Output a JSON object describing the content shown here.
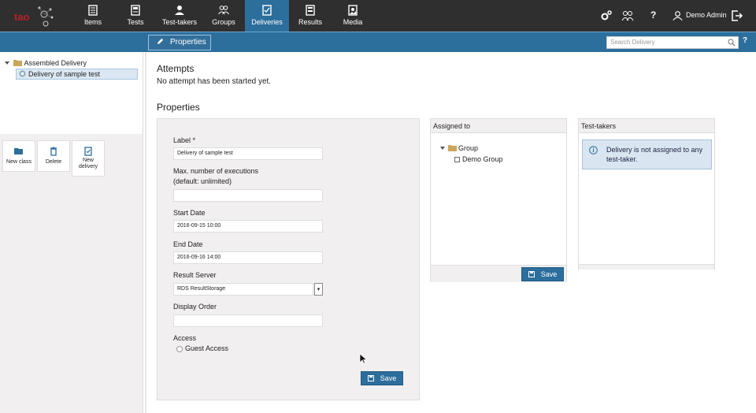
{
  "nav": {
    "items": [
      {
        "label": "Items",
        "icon": "items-icon"
      },
      {
        "label": "Tests",
        "icon": "tests-icon"
      },
      {
        "label": "Test-takers",
        "icon": "test-takers-icon"
      },
      {
        "label": "Groups",
        "icon": "groups-icon"
      },
      {
        "label": "Deliveries",
        "icon": "deliveries-icon",
        "active": true
      },
      {
        "label": "Results",
        "icon": "results-icon"
      },
      {
        "label": "Media",
        "icon": "media-icon"
      }
    ],
    "user_label": "Demo Admin",
    "help_label": "?"
  },
  "subbar": {
    "tab_label": "Properties",
    "search_placeholder": "Search Delivery",
    "help_label": "?"
  },
  "tree": {
    "root_label": "Assembled Delivery",
    "child_label": "Delivery of sample test"
  },
  "actions": {
    "new_class": "New class",
    "delete": "Delete",
    "new_delivery_line1": "New",
    "new_delivery_line2": "delivery"
  },
  "main": {
    "attempts_title": "Attempts",
    "attempts_note": "No attempt has been started yet.",
    "properties_title": "Properties"
  },
  "form": {
    "label_label": "Label *",
    "label_value": "Delivery of sample test",
    "max_exec_label_line1": "Max. number of executions",
    "max_exec_label_line2": "(default: unlimited)",
    "max_exec_value": "",
    "start_date_label": "Start Date",
    "start_date_value": "2016-09-15 10:00",
    "end_date_label": "End Date",
    "end_date_value": "2016-09-16 14:00",
    "result_server_label": "Result Server",
    "result_server_value": "RDS ResultStorage",
    "display_order_label": "Display Order",
    "display_order_value": "",
    "access_label": "Access",
    "guest_access_label": "Guest Access",
    "save_label": "Save"
  },
  "assigned": {
    "title": "Assigned to",
    "group_label": "Group",
    "demo_group_label": "Demo Group",
    "save_label": "Save"
  },
  "testtakers": {
    "title": "Test-takers",
    "info_line1": "Delivery is not assigned to any",
    "info_line2": "test-taker."
  },
  "colors": {
    "nav_bg": "#2f2f2f",
    "accent": "#2c6e9c",
    "panel_bg": "#f1efef",
    "info_bg": "#d9e6f1"
  }
}
